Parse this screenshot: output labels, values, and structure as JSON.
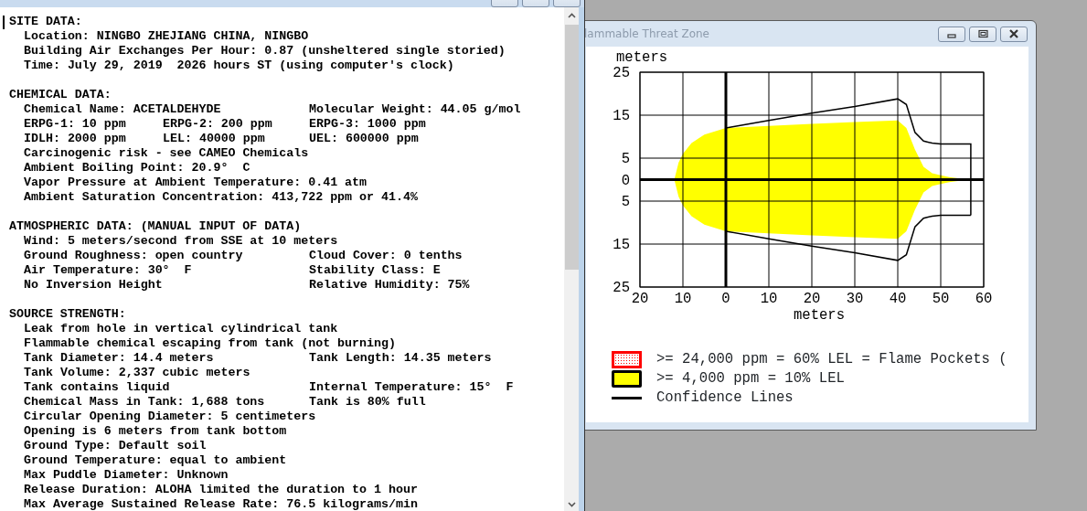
{
  "text_summary_window": {
    "sections": [
      {
        "heading": "SITE DATA:",
        "lines": [
          [
            "Location: NINGBO ZHEJIANG CHINA, NINGBO"
          ],
          [
            "Building Air Exchanges Per Hour: 0.87 (unsheltered single storied)"
          ],
          [
            "Time: July 29, 2019  2026 hours ST (using computer's clock)"
          ]
        ]
      },
      {
        "heading": "CHEMICAL DATA:",
        "lines": [
          [
            "Chemical Name: ACETALDEHYDE",
            "Molecular Weight: 44.05 g/mol"
          ],
          [
            "ERPG-1: 10 ppm",
            "ERPG-2: 200 ppm",
            "ERPG-3: 1000 ppm"
          ],
          [
            "IDLH: 2000 ppm",
            "LEL: 40000 ppm",
            "UEL: 600000 ppm"
          ],
          [
            "Carcinogenic risk - see CAMEO Chemicals"
          ],
          [
            "Ambient Boiling Point: 20.9°  C"
          ],
          [
            "Vapor Pressure at Ambient Temperature: 0.41 atm"
          ],
          [
            "Ambient Saturation Concentration: 413,722 ppm or 41.4%"
          ]
        ]
      },
      {
        "heading": "ATMOSPHERIC DATA: (MANUAL INPUT OF DATA)",
        "lines": [
          [
            "Wind: 5 meters/second from SSE at 10 meters"
          ],
          [
            "Ground Roughness: open country",
            "Cloud Cover: 0 tenths"
          ],
          [
            "Air Temperature: 30°  F",
            "Stability Class: E"
          ],
          [
            "No Inversion Height",
            "Relative Humidity: 75%"
          ]
        ]
      },
      {
        "heading": "SOURCE STRENGTH:",
        "lines": [
          [
            "Leak from hole in vertical cylindrical tank"
          ],
          [
            "Flammable chemical escaping from tank (not burning)"
          ],
          [
            "Tank Diameter: 14.4 meters",
            "Tank Length: 14.35 meters"
          ],
          [
            "Tank Volume: 2,337 cubic meters"
          ],
          [
            "Tank contains liquid",
            "Internal Temperature: 15°  F"
          ],
          [
            "Chemical Mass in Tank: 1,688 tons",
            "Tank is 80% full"
          ],
          [
            "Circular Opening Diameter: 5 centimeters"
          ],
          [
            "Opening is 6 meters from tank bottom"
          ],
          [
            "Ground Type: Default soil"
          ],
          [
            "Ground Temperature: equal to ambient"
          ],
          [
            "Max Puddle Diameter: Unknown"
          ],
          [
            "Release Duration: ALOHA limited the duration to 1 hour"
          ],
          [
            "Max Average Sustained Release Rate: 76.5 kilograms/min"
          ]
        ]
      }
    ]
  },
  "threat_zone_window": {
    "title": "lammable Threat Zone",
    "chart_data": {
      "type": "line",
      "xlabel": "meters",
      "ylabel": "meters",
      "xlim": [
        -20,
        60
      ],
      "ylim": [
        -25,
        25
      ],
      "xticks": [
        {
          "value": -20,
          "label": "20"
        },
        {
          "value": -10,
          "label": "10"
        },
        {
          "value": 0,
          "label": "0"
        },
        {
          "value": 10,
          "label": "10"
        },
        {
          "value": 20,
          "label": "20"
        },
        {
          "value": 30,
          "label": "30"
        },
        {
          "value": 40,
          "label": "40"
        },
        {
          "value": 50,
          "label": "50"
        },
        {
          "value": 60,
          "label": "60"
        }
      ],
      "yticks": [
        {
          "value": 25,
          "label": "25"
        },
        {
          "value": 15,
          "label": "15"
        },
        {
          "value": 5,
          "label": "5"
        },
        {
          "value": 0,
          "label": "0"
        },
        {
          "value": -5,
          "label": "5"
        },
        {
          "value": -15,
          "label": "15"
        },
        {
          "value": -25,
          "label": "25"
        }
      ],
      "grid": true,
      "x": [
        -12,
        -11,
        -10,
        -8,
        -5,
        0,
        10,
        20,
        30,
        40,
        42,
        44,
        46,
        48,
        50,
        52,
        54,
        56,
        57,
        57
      ],
      "series": [
        {
          "type": "area",
          "color": "#ffff00",
          "values": [
            0,
            4,
            6,
            8.5,
            10.5,
            12,
            12.5,
            13,
            13.4,
            13.8,
            12,
            7,
            3,
            1.5,
            1,
            0.6,
            0.3,
            0.1,
            0,
            null
          ]
        },
        {
          "type": "area",
          "color": "#ffff00",
          "values": [
            0,
            -4,
            -6,
            -8.5,
            -10.5,
            -12,
            -12.5,
            -13,
            -13.4,
            -13.8,
            -12,
            -7,
            -3,
            -1.5,
            -1,
            -0.6,
            -0.3,
            -0.1,
            0,
            null
          ]
        },
        {
          "type": "line",
          "color": "#000000",
          "values": [
            null,
            null,
            null,
            null,
            null,
            12,
            13.8,
            15.5,
            17,
            18.8,
            17.5,
            11,
            9,
            8.5,
            8.3,
            8.3,
            8.3,
            8.3,
            8.3,
            -8.3
          ]
        },
        {
          "type": "line",
          "color": "#000000",
          "values": [
            null,
            null,
            null,
            null,
            null,
            -12,
            -13.8,
            -15.5,
            -17,
            -18.8,
            -17.5,
            -11,
            -9,
            -8.5,
            -8.3,
            -8.3,
            -8.3,
            -8.3,
            -8.3,
            null
          ]
        }
      ]
    },
    "legend": [
      {
        "kind": "dotted",
        "label": ">= 24,000 ppm = 60% LEL = Flame Pockets ("
      },
      {
        "kind": "fill",
        "label": ">= 4,000 ppm = 10% LEL"
      },
      {
        "kind": "line",
        "label": "Confidence Lines"
      }
    ]
  }
}
